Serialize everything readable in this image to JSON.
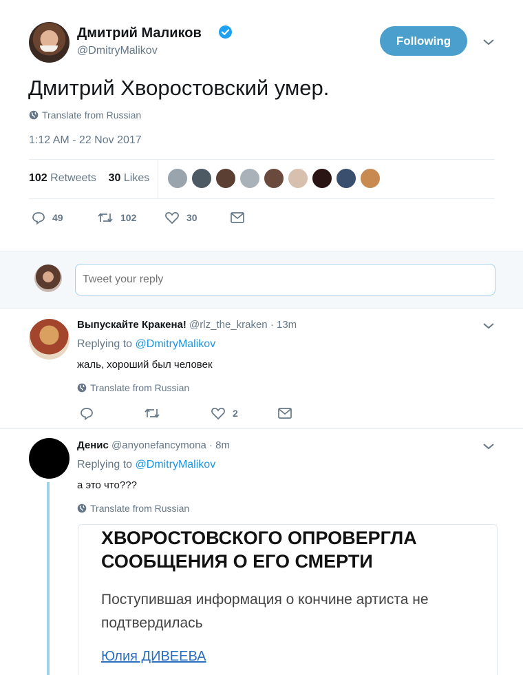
{
  "main_tweet": {
    "name": "Дмитрий Маликов",
    "handle": "@DmitryMalikov",
    "follow_label": "Following",
    "text": "Дмитрий Хворостовский умер.",
    "translate_label": "Translate from Russian",
    "timestamp": "1:12 AM - 22 Nov 2017",
    "stats": {
      "retweets_count": "102",
      "retweets_label": "Retweets",
      "likes_count": "30",
      "likes_label": "Likes"
    },
    "actions": {
      "replies": "49",
      "retweets": "102",
      "likes": "30"
    },
    "liker_colors": [
      "#9aa4ad",
      "#4d5a63",
      "#5b3f33",
      "#aab2b9",
      "#6a4a3c",
      "#d8c0ae",
      "#2a1414",
      "#3a4e6e",
      "#c98a52"
    ]
  },
  "reply_box": {
    "placeholder": "Tweet your reply"
  },
  "replies": [
    {
      "name": "Выпускайте Кракена!",
      "handle": "@rlz_the_kraken",
      "time": "· 13m",
      "replying_prefix": "Replying to",
      "replying_to": "@DmitryMalikov",
      "text": "жаль, хороший был человек",
      "translate_label": "Translate from Russian",
      "like_count": "2"
    },
    {
      "name": "Денис",
      "handle": "@anyonefancymona",
      "time": "· 8m",
      "replying_prefix": "Replying to",
      "replying_to": "@DmitryMalikov",
      "text": "а это что???",
      "translate_label": "Translate from Russian",
      "card": {
        "headline": "ХВОРОСТОВСКОГО ОПРОВЕРГЛА СООБЩЕНИЯ О ЕГО СМЕРТИ",
        "body": "Поступившая информация о кончине артиста не подтвердилась",
        "author": "Юлия ДИВЕЕВА"
      }
    }
  ],
  "colors": {
    "accent": "#1da1f2",
    "follow_button": "#4a9fcc",
    "muted": "#657786",
    "thread_line": "#9fd0ec"
  }
}
